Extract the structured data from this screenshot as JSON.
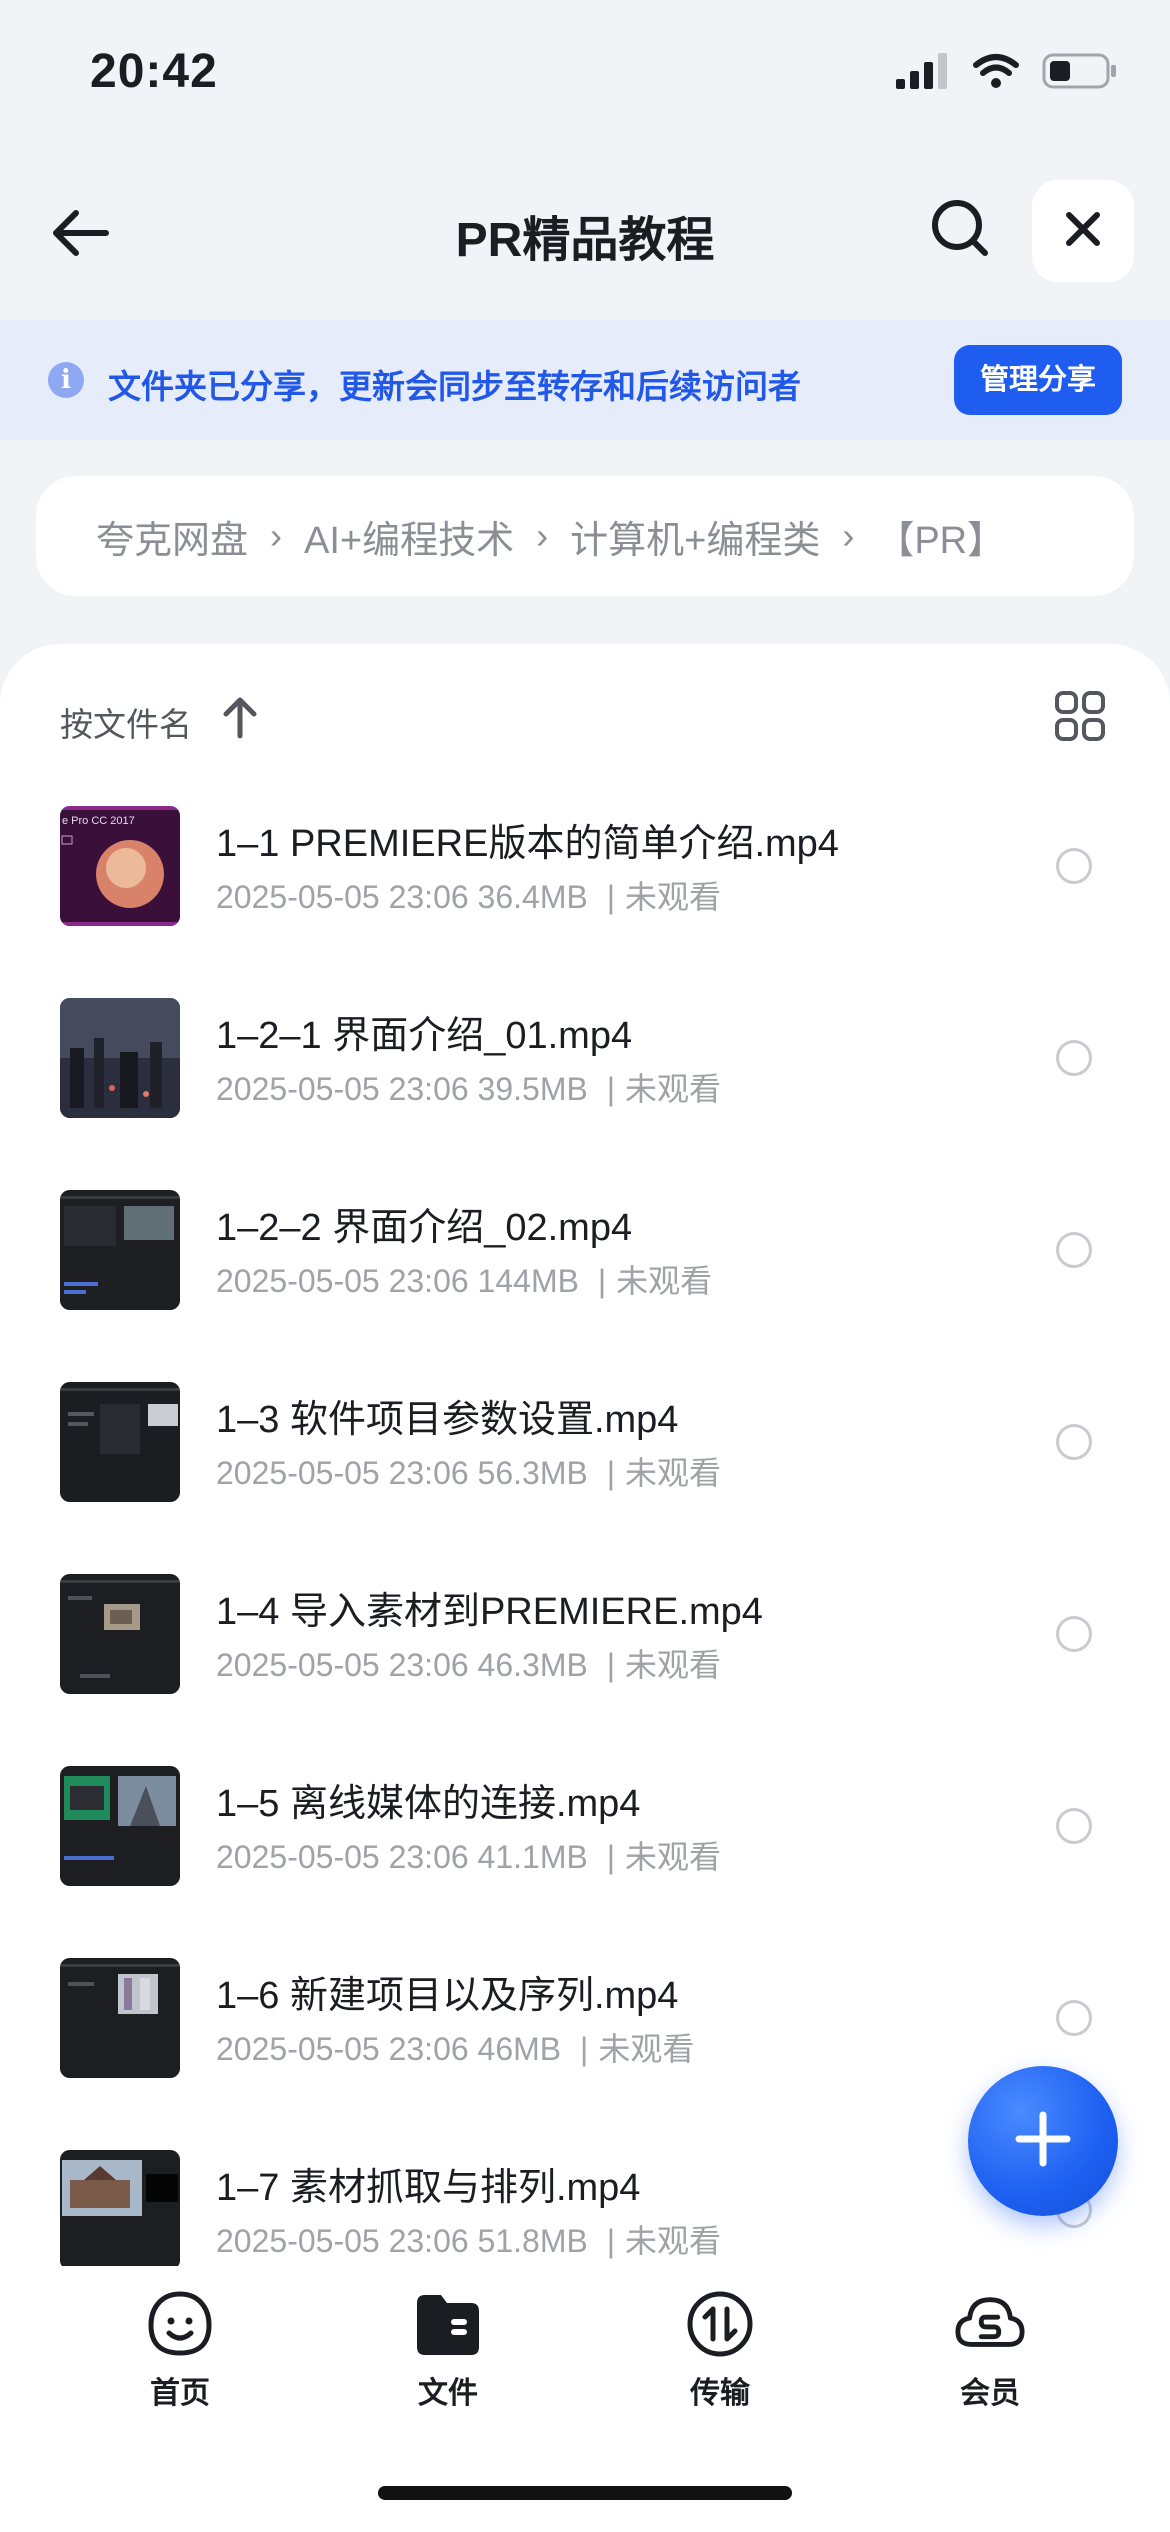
{
  "status_bar": {
    "time": "20:42",
    "signal_icon": "signal-bars-icon",
    "wifi_icon": "wifi-icon",
    "battery_icon": "battery-icon"
  },
  "nav": {
    "title": "PR精品教程",
    "back_icon": "arrow-left-icon",
    "search_icon": "search-icon",
    "close_icon": "close-icon"
  },
  "share_banner": {
    "text": "文件夹已分享，更新会同步至转存和后续访问者",
    "button": "管理分享",
    "info_icon": "info-icon",
    "info_glyph": "i"
  },
  "breadcrumb": {
    "items": [
      "夸克网盘",
      "AI+编程技术",
      "计算机+编程类",
      "【PR】"
    ],
    "separator": "›"
  },
  "sort": {
    "label": "按文件名",
    "direction_icon": "arrow-up-icon",
    "view_icon": "grid-view-icon"
  },
  "files": [
    {
      "name": "1–1 PREMIERE版本的简单介绍.mp4",
      "date": "2025-05-05 23:06",
      "size": "36.4MB",
      "status": "未观看",
      "thumb_caption": "e Pro CC 2017"
    },
    {
      "name": "1–2–1 界面介绍_01.mp4",
      "date": "2025-05-05 23:06",
      "size": "39.5MB",
      "status": "未观看"
    },
    {
      "name": "1–2–2 界面介绍_02.mp4",
      "date": "2025-05-05 23:06",
      "size": "144MB",
      "status": "未观看"
    },
    {
      "name": "1–3 软件项目参数设置.mp4",
      "date": "2025-05-05 23:06",
      "size": "56.3MB",
      "status": "未观看"
    },
    {
      "name": "1–4 导入素材到PREMIERE.mp4",
      "date": "2025-05-05 23:06",
      "size": "46.3MB",
      "status": "未观看"
    },
    {
      "name": "1–5 离线媒体的连接.mp4",
      "date": "2025-05-05 23:06",
      "size": "41.1MB",
      "status": "未观看"
    },
    {
      "name": "1–6 新建项目以及序列.mp4",
      "date": "2025-05-05 23:06",
      "size": "46MB",
      "status": "未观看"
    },
    {
      "name": "1–7 素材抓取与排列.mp4",
      "date": "2025-05-05 23:06",
      "size": "51.8MB",
      "status": "未观看"
    }
  ],
  "meta_separator": "|",
  "fab": {
    "icon": "plus-icon"
  },
  "tabs": [
    {
      "label": "首页",
      "icon": "smiley-home-icon"
    },
    {
      "label": "文件",
      "icon": "folder-icon"
    },
    {
      "label": "传输",
      "icon": "transfer-icon"
    },
    {
      "label": "会员",
      "icon": "member-cloud-icon"
    }
  ],
  "colors": {
    "accent": "#1f5df0",
    "banner_bg": "#e7ecfb",
    "banner_text": "#2158e8",
    "page_bg": "#f2f3f6"
  }
}
